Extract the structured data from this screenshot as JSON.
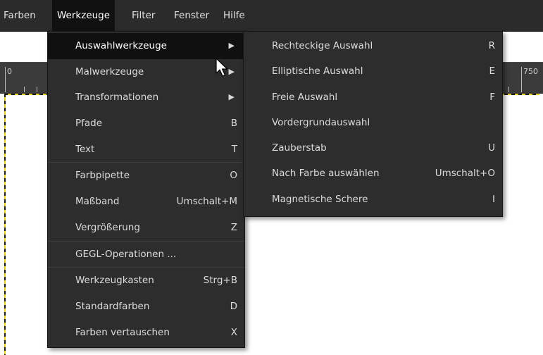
{
  "menubar": {
    "items": [
      {
        "label": "Farben"
      },
      {
        "label": "Werkzeuge"
      },
      {
        "label": "Filter"
      },
      {
        "label": "Fenster"
      },
      {
        "label": "Hilfe"
      }
    ]
  },
  "ruler": {
    "start_label": "0",
    "end_label": "750"
  },
  "werkzeuge_menu": {
    "items": [
      {
        "label": "Auswahlwerkzeuge",
        "submenu": true
      },
      {
        "label": "Malwerkzeuge",
        "submenu": true
      },
      {
        "label": "Transformationen",
        "submenu": true
      },
      {
        "label": "Pfade",
        "shortcut": "B"
      },
      {
        "label": "Text",
        "shortcut": "T"
      },
      {
        "label": "Farbpipette",
        "shortcut": "O"
      },
      {
        "label": "Maßband",
        "shortcut": "Umschalt+M"
      },
      {
        "label": "Vergrößerung",
        "shortcut": "Z"
      },
      {
        "label": "GEGL-Operationen ..."
      },
      {
        "label": "Werkzeugkasten",
        "shortcut": "Strg+B"
      },
      {
        "label": "Standardfarben",
        "shortcut": "D"
      },
      {
        "label": "Farben vertauschen",
        "shortcut": "X"
      }
    ]
  },
  "auswahl_menu": {
    "items": [
      {
        "label": "Rechteckige Auswahl",
        "shortcut": "R"
      },
      {
        "label": "Elliptische Auswahl",
        "shortcut": "E"
      },
      {
        "label": "Freie Auswahl",
        "shortcut": "F"
      },
      {
        "label": "Vordergrundauswahl"
      },
      {
        "label": "Zauberstab",
        "shortcut": "U"
      },
      {
        "label": "Nach Farbe auswählen",
        "shortcut": "Umschalt+O"
      },
      {
        "label": "Magnetische Schere",
        "shortcut": "I"
      }
    ]
  },
  "colors": {
    "menu_bg": "#2d2d2d",
    "highlight_bg": "#101010",
    "menubar_bg": "#2b2b2b",
    "selection_dash": "#e8d020"
  },
  "icons": {
    "submenu_arrow": "triangle-right-icon",
    "pointer": "mouse-pointer-icon"
  }
}
